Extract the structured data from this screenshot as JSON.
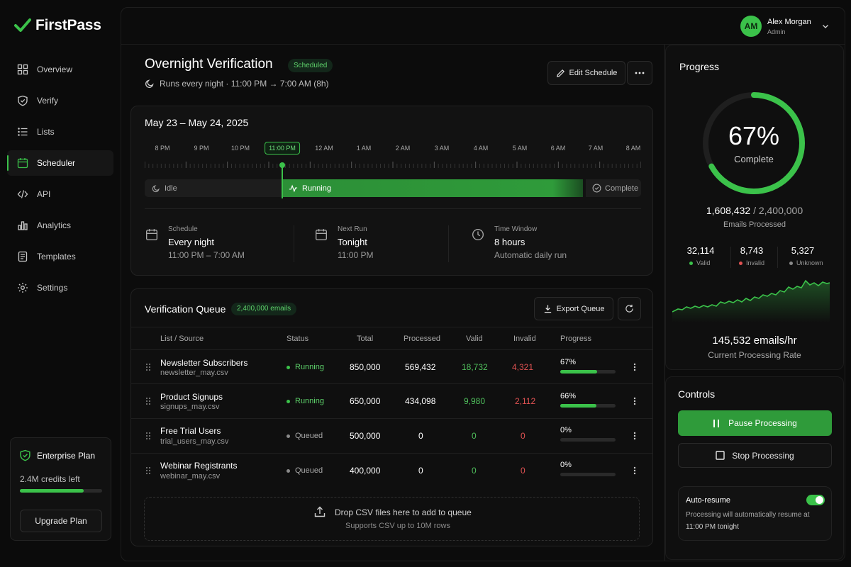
{
  "app": {
    "name": "FirstPass"
  },
  "user": {
    "initials": "AM",
    "name": "Alex Morgan",
    "role": "Admin"
  },
  "sidebar": {
    "items": [
      {
        "label": "Overview",
        "icon": "grid-icon"
      },
      {
        "label": "Verify",
        "icon": "shield-check-icon"
      },
      {
        "label": "Lists",
        "icon": "list-icon"
      },
      {
        "label": "Scheduler",
        "icon": "calendar-icon",
        "active": true
      },
      {
        "label": "API",
        "icon": "code-icon"
      },
      {
        "label": "Analytics",
        "icon": "bar-chart-icon"
      },
      {
        "label": "Templates",
        "icon": "document-icon"
      },
      {
        "label": "Settings",
        "icon": "gear-icon"
      }
    ],
    "plan": {
      "title": "Enterprise Plan",
      "credits": "2.4M credits left",
      "credits_fraction": 0.78,
      "upgrade_label": "Upgrade Plan"
    }
  },
  "header": {
    "title": "Overnight Verification",
    "badge": "Scheduled",
    "subtitle": "Runs every night · 11:00 PM → 7:00 AM (8h)",
    "edit_label": "Edit Schedule"
  },
  "timeline": {
    "date_range": "May 23 – May 24, 2025",
    "hours": [
      "8 PM",
      "9 PM",
      "10 PM",
      "11:00 PM",
      "12 AM",
      "1 AM",
      "2 AM",
      "3 AM",
      "4 AM",
      "5 AM",
      "6 AM",
      "7 AM",
      "8 AM"
    ],
    "current_hour_index": 3,
    "segments": {
      "idle": "Idle",
      "running": "Running",
      "complete": "Complete"
    },
    "info": [
      {
        "label": "Schedule",
        "value": "Every night",
        "sub": "11:00 PM – 7:00 AM",
        "icon": "calendar-icon"
      },
      {
        "label": "Next Run",
        "value": "Tonight",
        "sub": "11:00 PM",
        "icon": "calendar-icon"
      },
      {
        "label": "Time Window",
        "value": "8 hours",
        "sub": "Automatic daily run",
        "icon": "clock-icon"
      }
    ]
  },
  "queue": {
    "title": "Verification Queue",
    "badge": "2,400,000 emails",
    "export_label": "Export Queue",
    "columns": [
      "List / Source",
      "Status",
      "Total",
      "Processed",
      "Valid",
      "Invalid",
      "Progress"
    ],
    "rows": [
      {
        "name": "Newsletter Subscribers",
        "file": "newsletter_may.csv",
        "status": "Running",
        "total": "850,000",
        "processed": "569,432",
        "valid": "18,732",
        "invalid": "4,321",
        "progress_label": "67%",
        "progress": 0.67
      },
      {
        "name": "Product Signups",
        "file": "signups_may.csv",
        "status": "Running",
        "total": "650,000",
        "processed": "434,098",
        "valid": "9,980",
        "invalid": "2,112",
        "progress_label": "66%",
        "progress": 0.66
      },
      {
        "name": "Free Trial Users",
        "file": "trial_users_may.csv",
        "status": "Queued",
        "total": "500,000",
        "processed": "0",
        "valid": "0",
        "invalid": "0",
        "progress_label": "0%",
        "progress": 0
      },
      {
        "name": "Webinar Registrants",
        "file": "webinar_may.csv",
        "status": "Queued",
        "total": "400,000",
        "processed": "0",
        "valid": "0",
        "invalid": "0",
        "progress_label": "0%",
        "progress": 0
      }
    ],
    "dropzone": {
      "title": "Drop CSV files here to add to queue",
      "sub": "Supports CSV up to 10M rows"
    }
  },
  "progress": {
    "title": "Progress",
    "percent_label": "67%",
    "percent": 0.67,
    "complete_label": "Complete",
    "processed": "1,608,432",
    "total": "/ 2,400,000",
    "processed_label": "Emails Processed",
    "stats": [
      {
        "value": "32,114",
        "label": "Valid",
        "color": "#3bc24a"
      },
      {
        "value": "8,743",
        "label": "Invalid",
        "color": "#e05252"
      },
      {
        "value": "5,327",
        "label": "Unknown",
        "color": "#8a8a8a"
      }
    ],
    "rate": "145,532 emails/hr",
    "rate_label": "Current Processing Rate"
  },
  "controls": {
    "title": "Controls",
    "pause_label": "Pause Processing",
    "stop_label": "Stop Processing",
    "auto_resume": {
      "label": "Auto-resume",
      "enabled": true,
      "desc_line1": "Processing will automatically resume at",
      "desc_line2": "11:00 PM tonight"
    }
  },
  "colors": {
    "accent": "#3bc24a",
    "valid": "#3bc24a",
    "invalid": "#e05252",
    "queued": "#8a8a8a"
  }
}
